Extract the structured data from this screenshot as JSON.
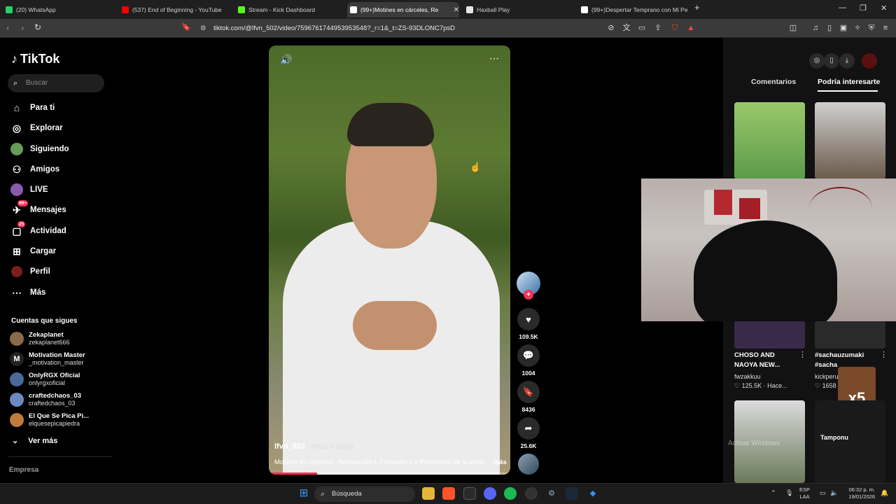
{
  "browser": {
    "tabs": [
      {
        "label": "(20) WhatsApp",
        "color": "#25d366"
      },
      {
        "label": "(537) End of Beginning - YouTube",
        "color": "#ff0000"
      },
      {
        "label": "Stream - Kick Dashboard",
        "color": "#53fc18"
      },
      {
        "label": "(99+)Motines en cárceles, Re",
        "color": "#ffffff"
      },
      {
        "label": "Haxball Play",
        "color": "#e5e5e5"
      },
      {
        "label": "(99+)Despertar Temprano con Mi Pe",
        "color": "#ffffff"
      }
    ],
    "new_tab": "+",
    "url": "tiktok.com/@lfvn_502/video/7596761744953953548?_r=1&_t=ZS-93DLONC7psD"
  },
  "sidebar": {
    "logo": "TikTok",
    "search_placeholder": "Buscar",
    "nav": [
      {
        "label": "Para ti",
        "icon": "home-icon"
      },
      {
        "label": "Explorar",
        "icon": "compass-icon"
      },
      {
        "label": "Siguiendo",
        "icon": "following-icon"
      },
      {
        "label": "Amigos",
        "icon": "friends-icon"
      },
      {
        "label": "LIVE",
        "icon": "live-icon"
      },
      {
        "label": "Mensajes",
        "icon": "messages-icon",
        "badge": "99+"
      },
      {
        "label": "Actividad",
        "icon": "activity-icon",
        "badge": "25"
      },
      {
        "label": "Cargar",
        "icon": "upload-icon"
      },
      {
        "label": "Perfil",
        "icon": "profile-icon"
      },
      {
        "label": "Más",
        "icon": "more-icon"
      }
    ],
    "following_title": "Cuentas que sigues",
    "accounts": [
      {
        "name": "Zekaplanet",
        "handle": "zekaplanet666",
        "color": "#8a6a4a"
      },
      {
        "name": "Motivation Master",
        "handle": "_motivation_master",
        "color": "#222222"
      },
      {
        "name": "OnlyRGX Oficial",
        "handle": "onlyrgxoficial",
        "color": "#4a6a9a"
      },
      {
        "name": "craftedchaos_03",
        "handle": "craftedchaos_03",
        "color": "#6a8ac0"
      },
      {
        "name": "El Que Se Pica Pi...",
        "handle": "elquesepicapiedra",
        "color": "#c07a3a"
      }
    ],
    "see_more": "Ver más",
    "company": "Empresa"
  },
  "video": {
    "author": "lfvn_502",
    "time": " · Hace 1 día(s)",
    "description": "Motines en cárceles, Renovación I, Fraijanes II y Preventivo de la zona",
    "more": "más",
    "progress": 0.2
  },
  "actions": {
    "likes": "109.5K",
    "comments": "1004",
    "saves": "8436",
    "shares": "25.6K"
  },
  "right_panel": {
    "tab_comments": "Comentarios",
    "tab_interest": "Podría interesarte",
    "videos": [
      {
        "title": "CHOSO AND NAOYA NEW...",
        "user": "fwzakkuu",
        "stats": "♡ 125.5K · Hace..."
      },
      {
        "title": "#sachauzumaki #sacha",
        "user": "kickperu",
        "stats": "♡ 1658"
      }
    ],
    "overlay_badge": "x5",
    "bottom_caption": "Tamponu"
  },
  "watermark": "Activar Windows",
  "taskbar": {
    "search": "Búsqueda",
    "lang_top": "ESP",
    "lang_bottom": "LAA",
    "time": "06:32 p. m.",
    "date": "19/01/2026"
  }
}
